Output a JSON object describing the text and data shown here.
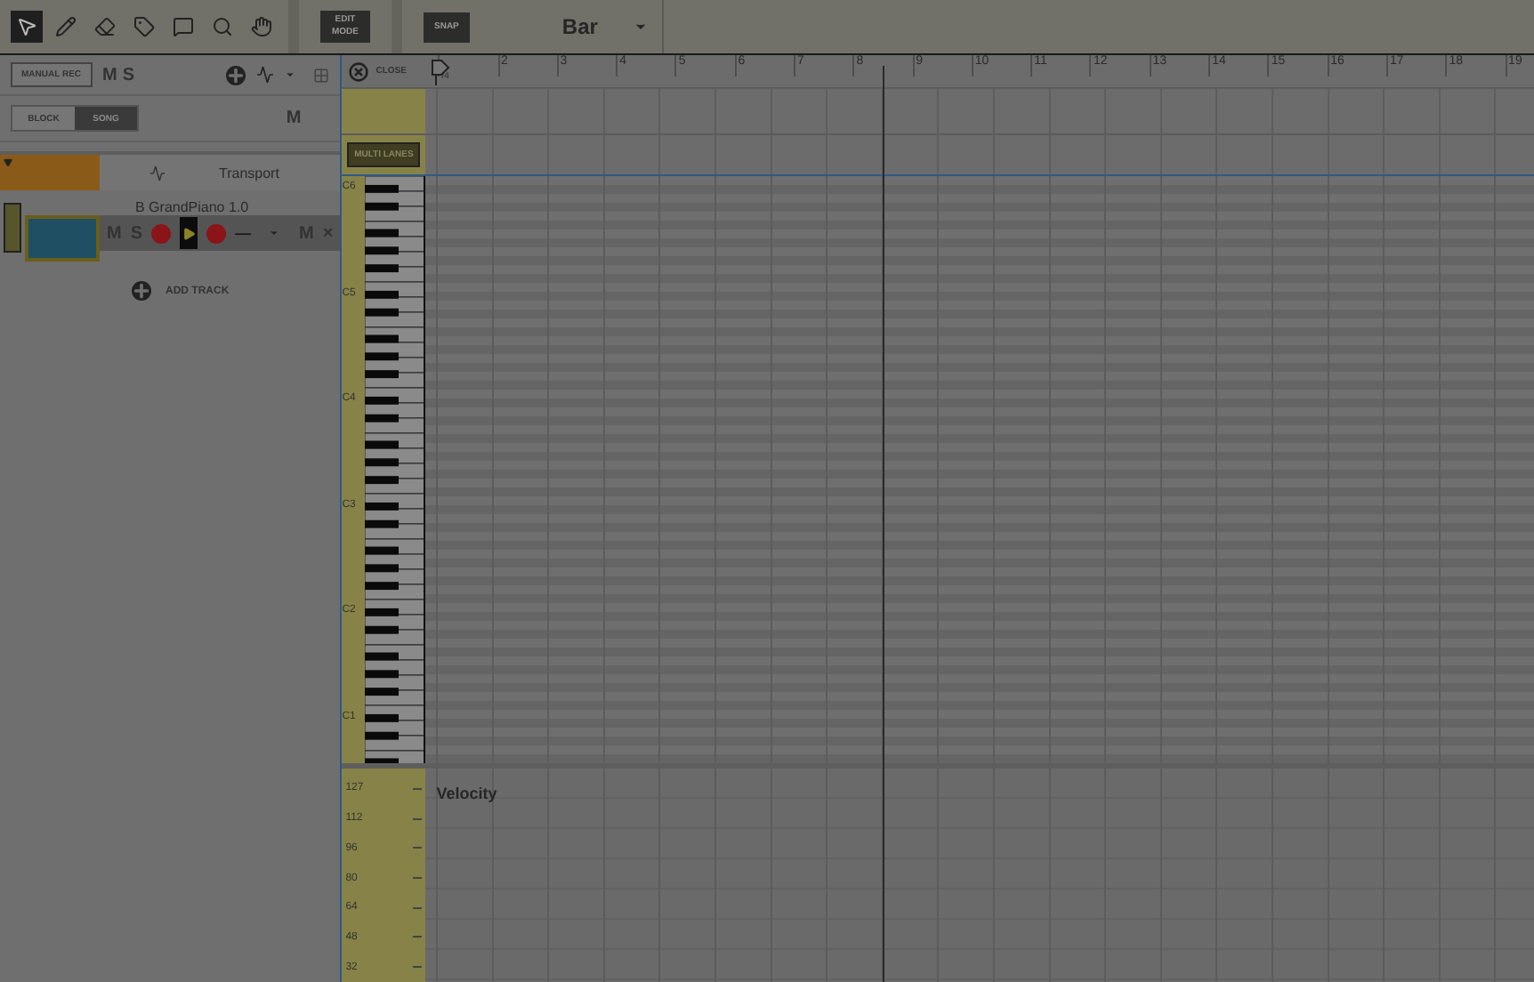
{
  "toolbar": {
    "tools": [
      {
        "kind": "pointer",
        "selected": true
      },
      {
        "kind": "pencil",
        "selected": false
      },
      {
        "kind": "eraser",
        "selected": false
      },
      {
        "kind": "tag",
        "selected": false
      },
      {
        "kind": "marker",
        "selected": false
      },
      {
        "kind": "zoom",
        "selected": false
      },
      {
        "kind": "hand",
        "selected": false
      }
    ],
    "edit_mode": "EDIT MODE",
    "snap": "SNAP",
    "snap_value": "Bar"
  },
  "sidebar": {
    "manual_rec": "MANUAL REC",
    "mute": "M",
    "solo": "S",
    "view_tabs": [
      {
        "label": "BLOCK",
        "selected": false
      },
      {
        "label": "SONG",
        "selected": true
      }
    ],
    "song_mute": "M",
    "transport": "Transport",
    "tracks": [
      {
        "name": "B GrandPiano 1.0",
        "mute": "M",
        "solo": "S",
        "level": "—",
        "mute_right": "M",
        "remove": "×"
      }
    ],
    "add_track": "ADD TRACK"
  },
  "ruler": {
    "close": "CLOSE",
    "first_label": "/4",
    "bars": [
      "2",
      "3",
      "4",
      "5",
      "6",
      "7",
      "8",
      "9",
      "10",
      "11",
      "12",
      "13",
      "14",
      "15",
      "16",
      "17",
      "18",
      "19"
    ]
  },
  "lanes": {
    "multi_lanes": "MULTI LANES"
  },
  "piano": {
    "octaves": [
      "C6",
      "C5",
      "C4",
      "C3",
      "C2",
      "C1"
    ]
  },
  "velocity": {
    "title": "Velocity",
    "ticks": [
      "127",
      "112",
      "96",
      "80",
      "64",
      "48",
      "32"
    ]
  }
}
